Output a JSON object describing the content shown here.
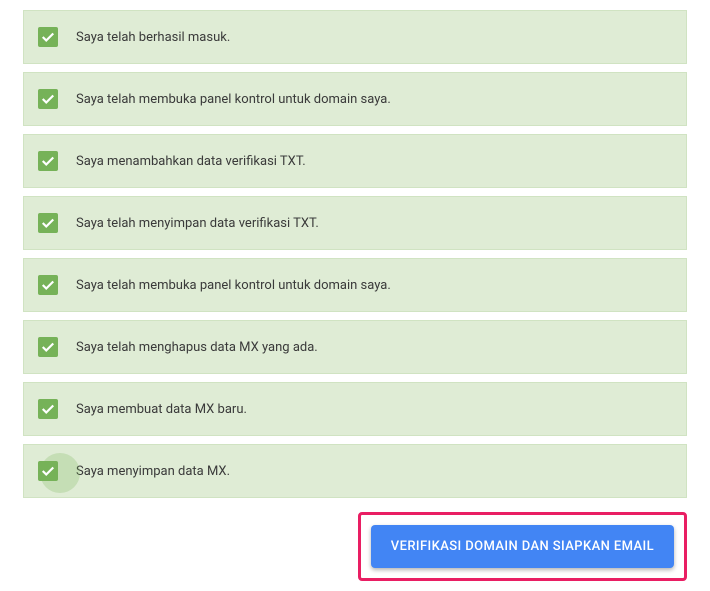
{
  "checklist": {
    "items": [
      {
        "label": "Saya telah berhasil masuk."
      },
      {
        "label": "Saya telah membuka panel kontrol untuk domain saya."
      },
      {
        "label": "Saya menambahkan data verifikasi TXT."
      },
      {
        "label": "Saya telah menyimpan data verifikasi TXT."
      },
      {
        "label": "Saya telah membuka panel kontrol untuk domain saya."
      },
      {
        "label": "Saya telah menghapus data MX yang ada."
      },
      {
        "label": "Saya membuat data MX baru."
      },
      {
        "label": "Saya menyimpan data MX."
      }
    ]
  },
  "action": {
    "verify_label": "VERIFIKASI DOMAIN DAN SIAPKAN EMAIL"
  }
}
